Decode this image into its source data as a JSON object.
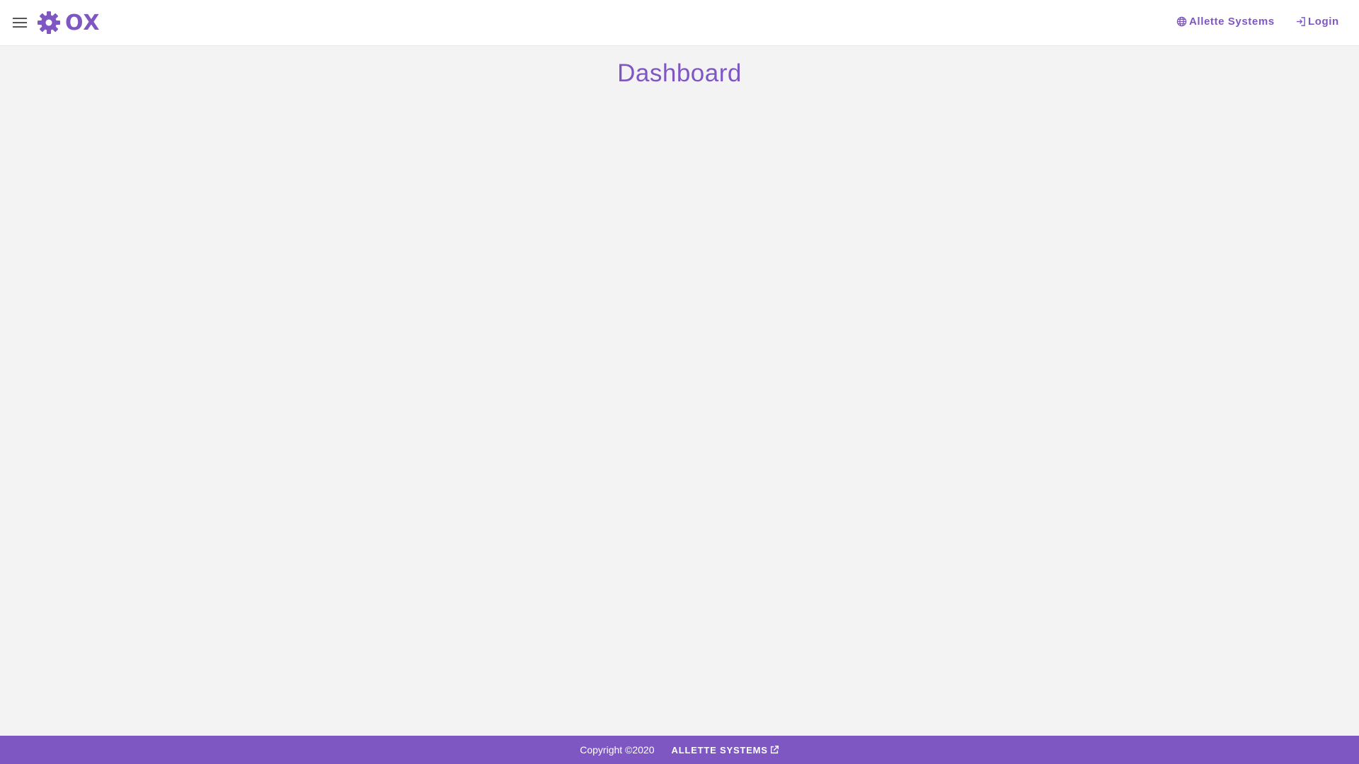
{
  "header": {
    "menu_icon": "menu-icon",
    "logo": {
      "text": "OX",
      "icon": "gear-icon",
      "color": "#7e57c2"
    },
    "nav": {
      "systems_label": "Allette Systems",
      "systems_icon": "globe-icon",
      "login_label": "Login",
      "login_icon": "login-icon"
    }
  },
  "main": {
    "title": "Dashboard"
  },
  "footer": {
    "copyright": "Copyright ©2020",
    "link_label": "ALLETTE SYSTEMS",
    "link_icon": "external-link-icon",
    "background": "#7e57c2"
  },
  "colors": {
    "accent": "#7e57c2",
    "page_background": "#f3f3f3",
    "header_background": "#ffffff"
  }
}
